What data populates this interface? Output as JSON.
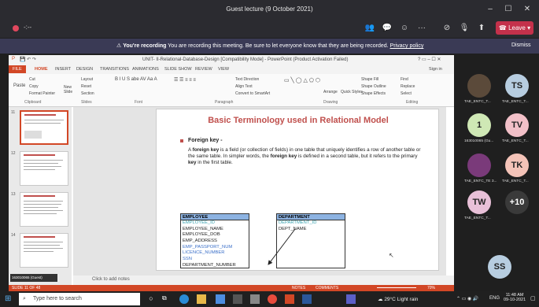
{
  "window": {
    "title": "Guest lecture (9 October 2021)"
  },
  "controls": {
    "leave_label": "Leave",
    "more_label": "···"
  },
  "banner": {
    "bold": "You're recording",
    "text": "You are recording this meeting. Be sure to let everyone know that they are being recorded.",
    "link": "Privacy policy",
    "dismiss": "Dismiss"
  },
  "ppt": {
    "title": "UNIT- II-Relational-Database-Design [Compatibility Mode] - PowerPoint (Product Activation Failed)",
    "signin": "Sign in",
    "tabs": [
      "FILE",
      "HOME",
      "INSERT",
      "DESIGN",
      "TRANSITIONS",
      "ANIMATIONS",
      "SLIDE SHOW",
      "REVIEW",
      "VIEW"
    ],
    "ribbon": {
      "cut": "Cut",
      "copy": "Copy",
      "paste": "Paste",
      "format_painter": "Format Painter",
      "new_slide": "New Slide",
      "layout": "Layout",
      "reset": "Reset",
      "section": "Section",
      "text_direction": "Text Direction",
      "align_text": "Align Text",
      "convert_smartart": "Convert to SmartArt",
      "arrange": "Arrange",
      "quick_styles": "Quick Styles",
      "shape_fill": "Shape Fill",
      "shape_outline": "Shape Outline",
      "shape_effects": "Shape Effects",
      "find": "Find",
      "replace": "Replace",
      "select": "Select",
      "groups": [
        "Clipboard",
        "Slides",
        "Font",
        "Paragraph",
        "Drawing",
        "Editing"
      ]
    },
    "thumb_numbers": [
      "11",
      "12",
      "13",
      "14"
    ],
    "notes_placeholder": "Click to add notes",
    "status_left": "SLIDE 11 OF 48",
    "status_notes": "NOTES",
    "status_comments": "COMMENTS",
    "zoom": "70%"
  },
  "slide": {
    "title": "Basic Terminology used in Relational Model",
    "bullet_head": "Foreign key -",
    "body_parts": [
      "A ",
      "foreign key",
      " is a field (or collection of fields) in one table that uniquely identifies a row of another table or the same table. In simpler words, the ",
      "foreign key",
      " is defined in a second table, but it refers to the primary ",
      "key",
      " in the first table."
    ],
    "employee": {
      "header": "EMPLOYEE",
      "rows": [
        "EMPLOYEE_ID",
        "EMPLOYEE_NAME",
        "EMPLOYEE_DOB",
        "EMP_ADDRESS",
        "EMP_PASSPORT_NUM",
        "LICENCE_NUMBER",
        "SSN",
        "DEPARTMENT_NUMBER"
      ]
    },
    "department": {
      "header": "DEPARTMENT",
      "rows": [
        "DEPARTMENT_ID",
        "DEPT_NAME"
      ]
    }
  },
  "participants": [
    {
      "initials": "",
      "name": "TAE_ENTC_T...",
      "color": "#5b4a3a"
    },
    {
      "initials": "TS",
      "name": "TAE_ENTC_T...",
      "color": "#b7cde0"
    },
    {
      "initials": "1",
      "name": "163010065 (Gu...",
      "color": "#cfe8b5"
    },
    {
      "initials": "TV",
      "name": "TAE_ENTC_T...",
      "color": "#f2c0c8"
    },
    {
      "initials": "",
      "name": "TAE_ENTC_TE 3...",
      "color": "#7a3a7a"
    },
    {
      "initials": "TK",
      "name": "TAE_ENTC_T...",
      "color": "#f4c3b8"
    },
    {
      "initials": "TW",
      "name": "TAE_ENTC_T...",
      "color": "#e8c0d8"
    },
    {
      "initials": "+10",
      "name": "",
      "color": "#3a3a3a"
    },
    {
      "initials": "SS",
      "name": "",
      "color": "#b7cde0"
    }
  ],
  "self_view_label": "163010065 (Guest)",
  "taskbar": {
    "search_placeholder": "Type here to search",
    "weather": "29°C  Light rain",
    "lang": "ENG",
    "time": "11:48 AM",
    "date": "09-10-2021"
  }
}
